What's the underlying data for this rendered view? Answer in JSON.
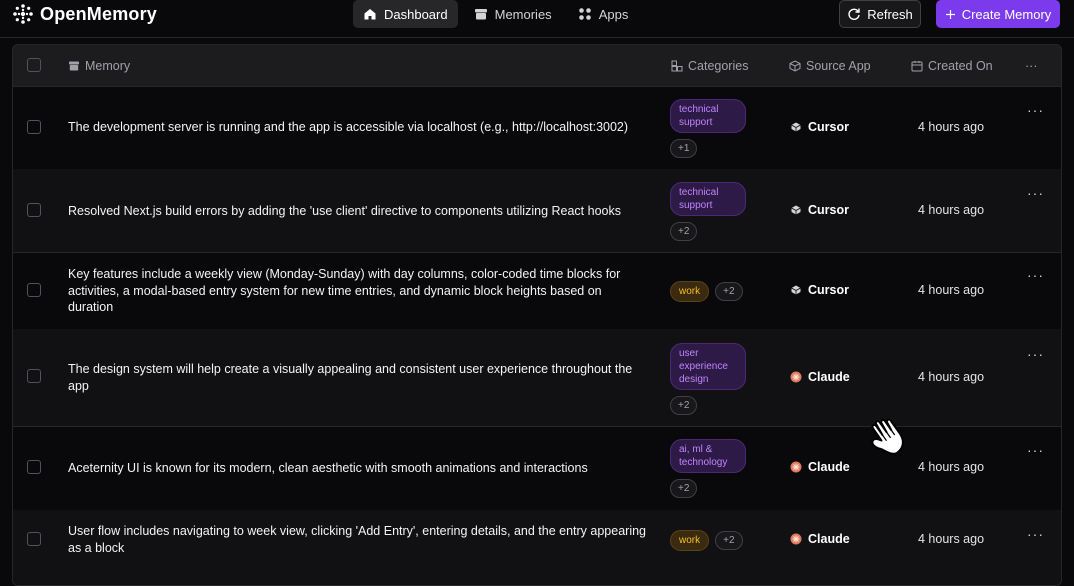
{
  "app": {
    "name": "OpenMemory"
  },
  "nav": [
    {
      "label": "Dashboard",
      "icon": "home-icon",
      "active": true
    },
    {
      "label": "Memories",
      "icon": "archive-icon",
      "active": false
    },
    {
      "label": "Apps",
      "icon": "apps-icon",
      "active": false
    }
  ],
  "actions": {
    "refresh_label": "Refresh",
    "create_label": "Create Memory"
  },
  "table": {
    "headers": {
      "memory": "Memory",
      "categories": "Categories",
      "source_app": "Source App",
      "created_on": "Created On",
      "more": "···"
    },
    "rows": [
      {
        "text": "The development server is running and the app is accessible via localhost (e.g., http://localhost:3002)",
        "category": "technical support",
        "more": "+1",
        "source": "Cursor",
        "created": "4 hours ago"
      },
      {
        "text": "Resolved Next.js build errors by adding the 'use client' directive to components utilizing React hooks",
        "category": "technical support",
        "more": "+2",
        "source": "Cursor",
        "created": "4 hours ago"
      },
      {
        "text": "Key features include a weekly view (Monday-Sunday) with day columns, color-coded time blocks for activities, a modal-based entry system for new time entries, and dynamic block heights based on duration",
        "category": "work",
        "more": "+2",
        "source": "Cursor",
        "created": "4 hours ago"
      },
      {
        "text": "The design system will help create a visually appealing and consistent user experience throughout the app",
        "category": "user experience design",
        "more": "+2",
        "source": "Claude",
        "created": "4 hours ago"
      },
      {
        "text": "Aceternity UI is known for its modern, clean aesthetic with smooth animations and interactions",
        "category": "ai, ml & technology",
        "more": "+2",
        "source": "Claude",
        "created": "4 hours ago"
      },
      {
        "text": "User flow includes navigating to week view, clicking 'Add Entry', entering details, and the entry appearing as a block",
        "category": "work",
        "more": "+2",
        "source": "Claude",
        "created": "4 hours ago"
      }
    ],
    "row_more": "···"
  },
  "colors": {
    "accent": "#7c3aed",
    "tag_purple": "#c084fc",
    "tag_work": "#fbbf24",
    "claude": "#e07a5f"
  }
}
